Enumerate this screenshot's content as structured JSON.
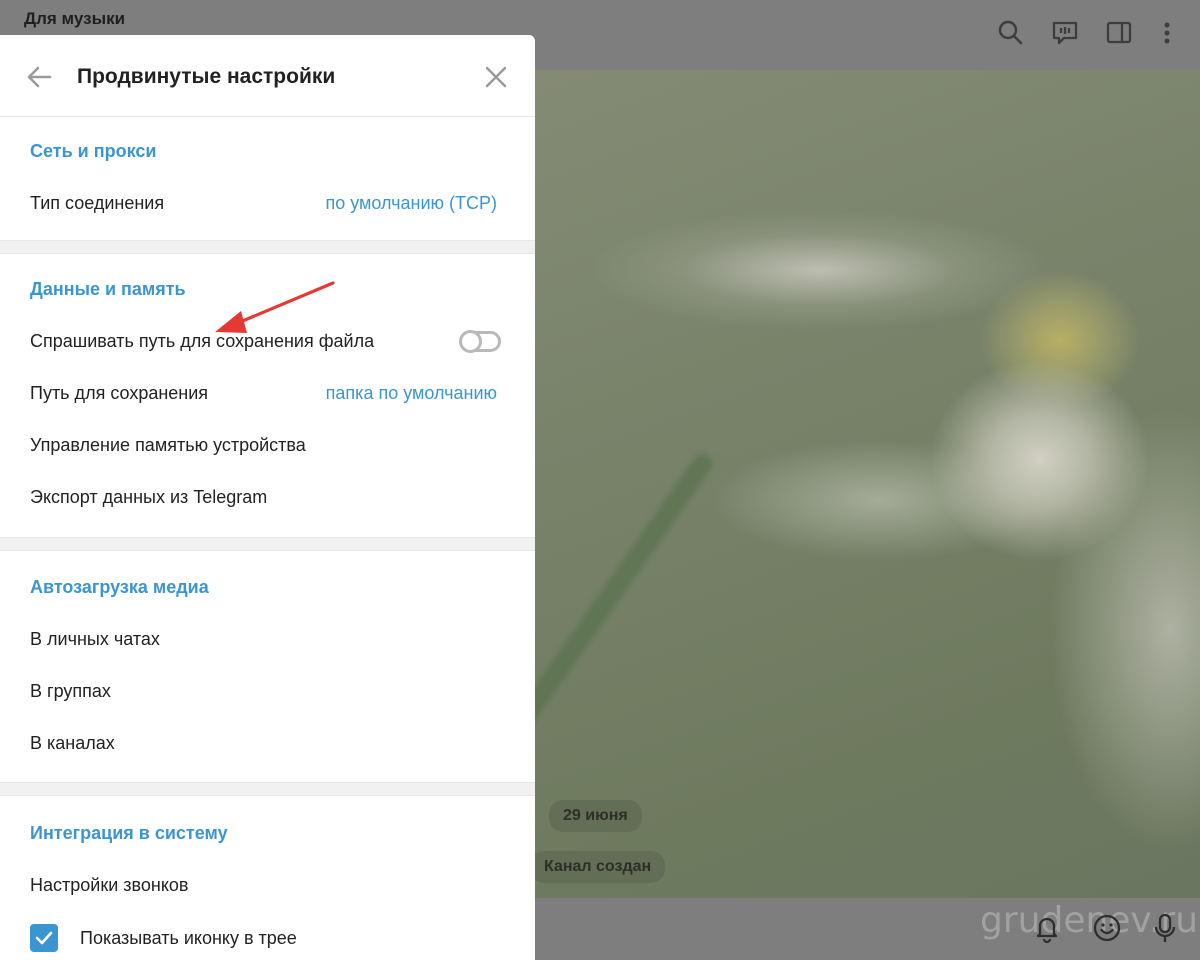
{
  "chat": {
    "title": "Для музыки",
    "date_pill": "29 июня",
    "service_message": "Канал создан",
    "watermark": "grudenev.ru",
    "header_icons": [
      "search-icon",
      "voice-chat-icon",
      "sidebar-toggle-icon",
      "more-vertical-icon"
    ],
    "bottom_icons": [
      "bell-icon",
      "emoji-icon",
      "microphone-icon"
    ]
  },
  "panel": {
    "title": "Продвинутые настройки",
    "sections": {
      "network": {
        "title": "Сеть и прокси",
        "connection_type_label": "Тип соединения",
        "connection_type_value": "по умолчанию (TCP)"
      },
      "data": {
        "title": "Данные и память",
        "ask_path_label": "Спрашивать путь для сохранения файла",
        "ask_path_enabled": false,
        "save_path_label": "Путь для сохранения",
        "save_path_value": "папка по умолчанию",
        "storage_label": "Управление памятью устройства",
        "export_label": "Экспорт данных из Telegram"
      },
      "autoload": {
        "title": "Автозагрузка медиа",
        "private_chats": "В личных чатах",
        "groups": "В группах",
        "channels": "В каналах"
      },
      "integration": {
        "title": "Интеграция в систему",
        "call_settings": "Настройки звонков",
        "tray_icon_label": "Показывать иконку в трее",
        "tray_icon_checked": true
      }
    }
  },
  "colors": {
    "accent": "#3a95d1",
    "annotation_arrow": "#e53935"
  }
}
